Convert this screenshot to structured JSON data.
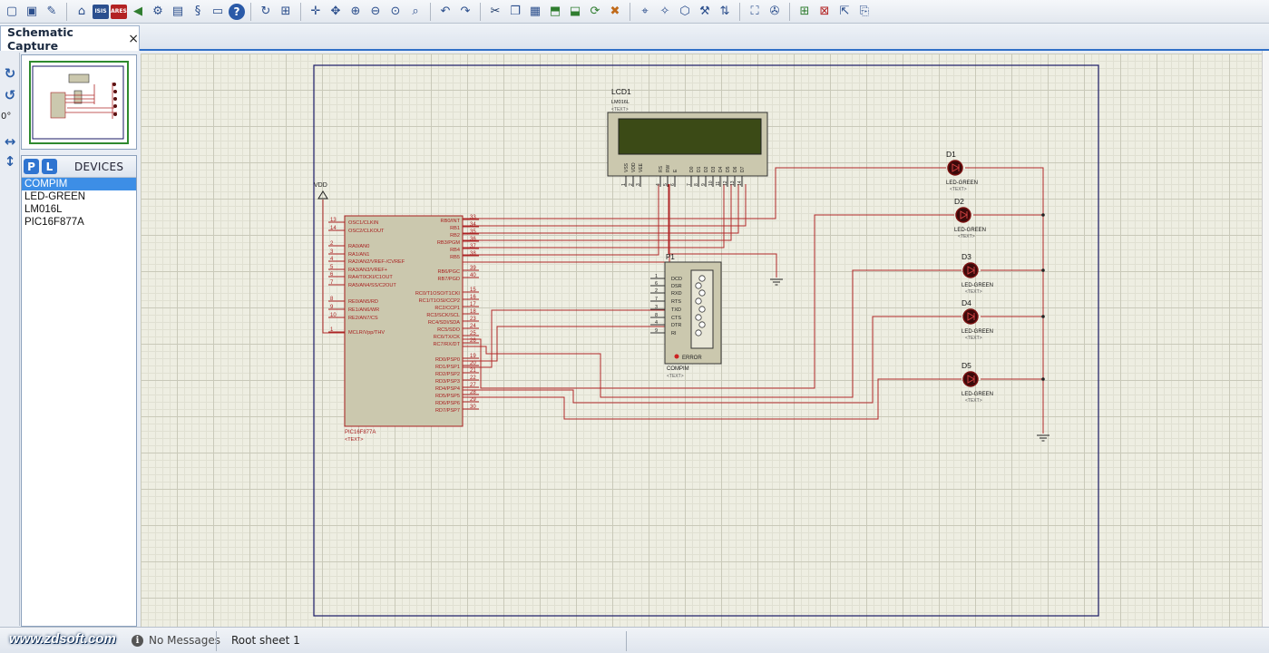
{
  "toolbar": {
    "buttons": [
      {
        "name": "new-file-icon",
        "glyph": "▢"
      },
      {
        "name": "save-icon",
        "glyph": "▣"
      },
      {
        "name": "edit-icon",
        "glyph": "✎"
      },
      {
        "name": "home-icon",
        "glyph": "⌂"
      },
      {
        "name": "isis-icon",
        "glyph": "ISIS"
      },
      {
        "name": "ares-icon",
        "glyph": "ARES"
      },
      {
        "name": "back-icon",
        "glyph": "◀"
      },
      {
        "name": "simulate-icon",
        "glyph": "⚙"
      },
      {
        "name": "bom-icon",
        "glyph": "▤"
      },
      {
        "name": "source-icon",
        "glyph": "§"
      },
      {
        "name": "meter-icon",
        "glyph": "▭"
      },
      {
        "name": "help-icon",
        "glyph": "?"
      },
      {
        "name": "refresh-icon",
        "glyph": "↻"
      },
      {
        "name": "grid-icon",
        "glyph": "⊞"
      },
      {
        "name": "origin-icon",
        "glyph": "✛"
      },
      {
        "name": "pan-icon",
        "glyph": "✥"
      },
      {
        "name": "zoom-in-icon",
        "glyph": "⊕"
      },
      {
        "name": "zoom-out-icon",
        "glyph": "⊖"
      },
      {
        "name": "zoom-all-icon",
        "glyph": "⊙"
      },
      {
        "name": "zoom-area-icon",
        "glyph": "⌕"
      },
      {
        "name": "undo-icon",
        "glyph": "↶"
      },
      {
        "name": "redo-icon",
        "glyph": "↷"
      },
      {
        "name": "cut-icon",
        "glyph": "✂"
      },
      {
        "name": "copy-icon",
        "glyph": "❐"
      },
      {
        "name": "paste-icon",
        "glyph": "▦"
      },
      {
        "name": "block-copy-icon",
        "glyph": "⬒"
      },
      {
        "name": "block-move-icon",
        "glyph": "⬓"
      },
      {
        "name": "block-rotate-icon",
        "glyph": "⟳"
      },
      {
        "name": "block-delete-icon",
        "glyph": "✖"
      },
      {
        "name": "pick-device-icon",
        "glyph": "⌖"
      },
      {
        "name": "make-device-icon",
        "glyph": "✧"
      },
      {
        "name": "packaging-icon",
        "glyph": "⬡"
      },
      {
        "name": "decompose-icon",
        "glyph": "⚒"
      },
      {
        "name": "wire-autorouter-icon",
        "glyph": "⇅"
      },
      {
        "name": "search-icon",
        "glyph": "⛶"
      },
      {
        "name": "property-tool-icon",
        "glyph": "✇"
      },
      {
        "name": "new-sheet-icon",
        "glyph": "⊞"
      },
      {
        "name": "remove-sheet-icon",
        "glyph": "⊠"
      },
      {
        "name": "exit-sheet-icon",
        "glyph": "⇱"
      },
      {
        "name": "design-notes-icon",
        "glyph": "⎘"
      }
    ]
  },
  "tab": {
    "label": "Schematic Capture",
    "close": "×"
  },
  "lefttools": {
    "rotate_cw": "↻",
    "rotate_ccw": "↺",
    "angle": "0°",
    "mirror_h": "↔",
    "mirror_v": "↕"
  },
  "devices": {
    "p_button": "P",
    "l_button": "L",
    "title": "DEVICES",
    "items": [
      "COMPIM",
      "LED-GREEN",
      "LM016L",
      "PIC16F877A"
    ],
    "selected_index": 0
  },
  "schematic": {
    "vdd_label": "VDD",
    "mcu": {
      "ref": "PIC16F877A",
      "text": "<TEXT>",
      "left_pins": [
        {
          "num": "13",
          "name": "OSC1/CLKIN"
        },
        {
          "num": "14",
          "name": "OSC2/CLKOUT"
        },
        {
          "num": "2",
          "name": "RA0/AN0"
        },
        {
          "num": "3",
          "name": "RA1/AN1"
        },
        {
          "num": "4",
          "name": "RA2/AN2/VREF-/CVREF"
        },
        {
          "num": "5",
          "name": "RA3/AN3/VREF+"
        },
        {
          "num": "6",
          "name": "RA4/T0CKI/C1OUT"
        },
        {
          "num": "7",
          "name": "RA5/AN4/SS/C2OUT"
        },
        {
          "num": "8",
          "name": "RE0/AN5/RD"
        },
        {
          "num": "9",
          "name": "RE1/AN6/WR"
        },
        {
          "num": "10",
          "name": "RE2/AN7/CS"
        },
        {
          "num": "1",
          "name": "MCLR/Vpp/THV"
        }
      ],
      "right_pins": [
        {
          "num": "33",
          "name": "RB0/INT"
        },
        {
          "num": "34",
          "name": "RB1"
        },
        {
          "num": "35",
          "name": "RB2"
        },
        {
          "num": "36",
          "name": "RB3/PGM"
        },
        {
          "num": "37",
          "name": "RB4"
        },
        {
          "num": "38",
          "name": "RB5"
        },
        {
          "num": "39",
          "name": "RB6/PGC"
        },
        {
          "num": "40",
          "name": "RB7/PGD"
        },
        {
          "num": "15",
          "name": "RC0/T1OSO/T1CKI"
        },
        {
          "num": "16",
          "name": "RC1/T1OSI/CCP2"
        },
        {
          "num": "17",
          "name": "RC2/CCP1"
        },
        {
          "num": "18",
          "name": "RC3/SCK/SCL"
        },
        {
          "num": "23",
          "name": "RC4/SDI/SDA"
        },
        {
          "num": "24",
          "name": "RC5/SDO"
        },
        {
          "num": "25",
          "name": "RC6/TX/CK"
        },
        {
          "num": "26",
          "name": "RC7/RX/DT"
        },
        {
          "num": "19",
          "name": "RD0/PSP0"
        },
        {
          "num": "20",
          "name": "RD1/PSP1"
        },
        {
          "num": "21",
          "name": "RD2/PSP2"
        },
        {
          "num": "22",
          "name": "RD3/PSP3"
        },
        {
          "num": "27",
          "name": "RD4/PSP4"
        },
        {
          "num": "28",
          "name": "RD5/PSP5"
        },
        {
          "num": "29",
          "name": "RD6/PSP6"
        },
        {
          "num": "30",
          "name": "RD7/PSP7"
        }
      ]
    },
    "lcd": {
      "ref": "LCD1",
      "part": "LM016L",
      "text": "<TEXT>",
      "pin_names": [
        "VSS",
        "VDD",
        "VEE",
        "RS",
        "RW",
        "E",
        "D0",
        "D1",
        "D2",
        "D3",
        "D4",
        "D5",
        "D6",
        "D7"
      ],
      "pin_nums": [
        "1",
        "2",
        "3",
        "4",
        "5",
        "6",
        "7",
        "8",
        "9",
        "10",
        "11",
        "12",
        "13",
        "14"
      ]
    },
    "compim": {
      "ref": "P1",
      "part": "COMPIM",
      "text": "<TEXT>",
      "error": "ERROR",
      "pins": [
        {
          "num": "1",
          "name": "DCD"
        },
        {
          "num": "6",
          "name": "DSR"
        },
        {
          "num": "2",
          "name": "RXD"
        },
        {
          "num": "7",
          "name": "RTS"
        },
        {
          "num": "3",
          "name": "TXD"
        },
        {
          "num": "8",
          "name": "CTS"
        },
        {
          "num": "4",
          "name": "DTR"
        },
        {
          "num": "9",
          "name": "RI"
        }
      ]
    },
    "leds": [
      {
        "ref": "D1",
        "part": "LED-GREEN",
        "text": "<TEXT>"
      },
      {
        "ref": "D2",
        "part": "LED-GREEN",
        "text": "<TEXT>"
      },
      {
        "ref": "D3",
        "part": "LED-GREEN",
        "text": "<TEXT>"
      },
      {
        "ref": "D4",
        "part": "LED-GREEN",
        "text": "<TEXT>"
      },
      {
        "ref": "D5",
        "part": "LED-GREEN",
        "text": "<TEXT>"
      }
    ],
    "colors": {
      "component": "#a82020",
      "body": "#cbc8ae",
      "wire": "#b02828",
      "sheet": "#1a1a66",
      "lcd_screen": "#3b4a16"
    }
  },
  "status": {
    "watermark": "www.zdsoft.com",
    "messages": "No Messages",
    "sheet": "Root sheet 1"
  }
}
